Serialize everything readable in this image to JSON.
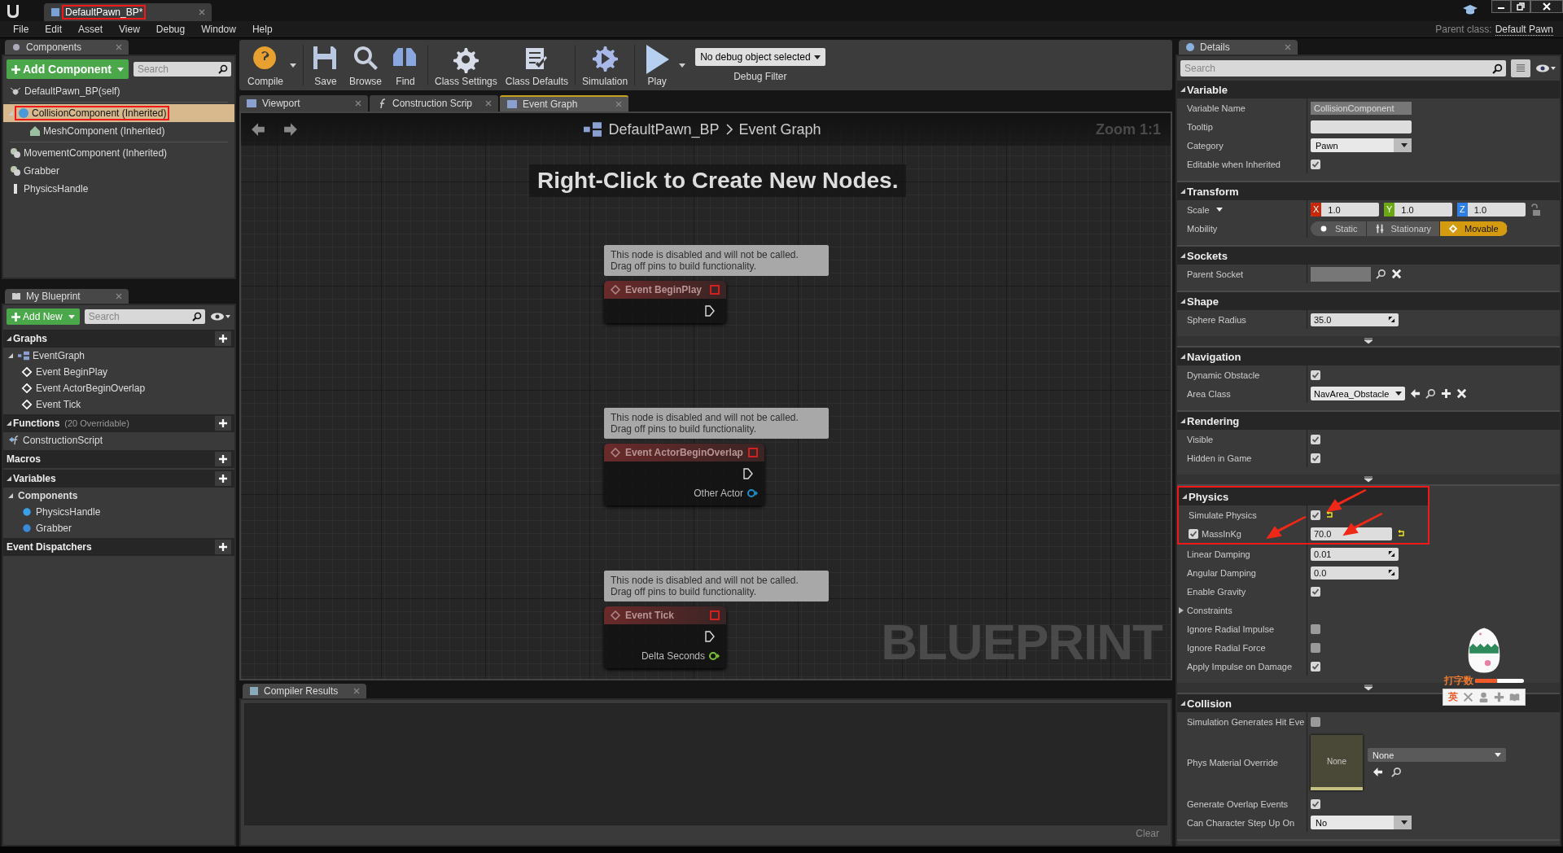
{
  "window": {
    "tab": "DefaultPawn_BP*",
    "tab_highlighted": true,
    "parent_class_label": "Parent class:",
    "parent_class": "Default Pawn"
  },
  "menu": [
    "File",
    "Edit",
    "Asset",
    "View",
    "Debug",
    "Window",
    "Help"
  ],
  "components_panel": {
    "title": "Components",
    "add_button": "Add Component",
    "search_placeholder": "Search",
    "self": "DefaultPawn_BP(self)",
    "items": [
      {
        "label": "CollisionComponent (Inherited)",
        "kind": "sphere",
        "selected": true,
        "highlighted": true,
        "children": [
          {
            "label": "MeshComponent (Inherited)",
            "kind": "mesh",
            "selected": false,
            "highlighted": false
          }
        ]
      },
      {
        "label": "MovementComponent (Inherited)",
        "kind": "movement",
        "selected": false,
        "highlighted": false
      },
      {
        "label": "Grabber",
        "kind": "grabber",
        "selected": false,
        "highlighted": false
      },
      {
        "label": "PhysicsHandle",
        "kind": "handle",
        "selected": false,
        "highlighted": false
      }
    ]
  },
  "my_blueprint": {
    "title": "My Blueprint",
    "add_button": "Add New",
    "search_placeholder": "Search",
    "sections": [
      {
        "title": "Graphs",
        "expanded": true,
        "items": [
          {
            "label": "EventGraph",
            "kind": "graph",
            "children": [
              {
                "label": "Event BeginPlay",
                "kind": "event"
              },
              {
                "label": "Event ActorBeginOverlap",
                "kind": "event"
              },
              {
                "label": "Event Tick",
                "kind": "event"
              }
            ]
          }
        ]
      },
      {
        "title": "Functions",
        "note": "(20 Overridable)",
        "expanded": true,
        "items": [
          {
            "label": "ConstructionScript",
            "kind": "function"
          }
        ]
      },
      {
        "title": "Macros"
      },
      {
        "title": "Variables",
        "expanded": true,
        "items": [
          {
            "label": "Components",
            "kind": "category",
            "children": [
              {
                "label": "PhysicsHandle",
                "kind": "handle"
              },
              {
                "label": "Grabber",
                "kind": "grabber"
              }
            ]
          }
        ]
      },
      {
        "title": "Event Dispatchers"
      }
    ]
  },
  "toolbar": [
    {
      "label": "Compile",
      "kind": "compile",
      "dropdown": true
    },
    {
      "label": "Save",
      "kind": "save",
      "dropdown": false
    },
    {
      "label": "Browse",
      "kind": "browse",
      "dropdown": false
    },
    {
      "label": "Find",
      "kind": "find",
      "dropdown": false
    },
    {
      "label": "Class Settings",
      "kind": "settings",
      "dropdown": false
    },
    {
      "label": "Class Defaults",
      "kind": "defaults",
      "dropdown": false
    },
    {
      "label": "Simulation",
      "kind": "simulation",
      "dropdown": false
    },
    {
      "label": "Play",
      "kind": "play",
      "dropdown": true
    }
  ],
  "debug_filter": {
    "value": "No debug object selected",
    "label": "Debug Filter"
  },
  "doc_tabs": [
    {
      "label": "Viewport",
      "kind": "viewport",
      "selected": false
    },
    {
      "label": "Construction Scrip",
      "kind": "function",
      "selected": false
    },
    {
      "label": "Event Graph",
      "kind": "graph",
      "selected": true
    }
  ],
  "graph": {
    "breadcrumb": [
      "DefaultPawn_BP",
      "Event Graph"
    ],
    "zoom": "Zoom 1:1",
    "hint": "Right-Click to Create New Nodes.",
    "watermark": "BLUEPRINT",
    "nodes": [
      {
        "comment": [
          "This node is disabled and will not be called.",
          "Drag off pins to build functionality."
        ],
        "title": "Event BeginPlay"
      },
      {
        "comment": [
          "This node is disabled and will not be called.",
          "Drag off pins to build functionality."
        ],
        "title": "Event ActorBeginOverlap",
        "pin": {
          "label": "Other Actor",
          "color": "#1a8fd0"
        }
      },
      {
        "comment": [
          "This node is disabled and will not be called.",
          "Drag off pins to build functionality."
        ],
        "title": "Event Tick",
        "pin": {
          "label": "Delta Seconds",
          "color": "#7cc432"
        }
      }
    ]
  },
  "compiler_results": {
    "title": "Compiler Results",
    "clear": "Clear"
  },
  "details": {
    "title": "Details",
    "search_placeholder": "Search",
    "sections": [
      {
        "title": "Variable",
        "rows": [
          {
            "label": "Variable Name",
            "kind": "readonly",
            "value": "CollisionComponent"
          },
          {
            "label": "Tooltip",
            "kind": "text"
          },
          {
            "label": "Category",
            "kind": "combo",
            "value": "Pawn"
          },
          {
            "label": "Editable when Inherited",
            "kind": "check",
            "checked": true
          }
        ]
      },
      {
        "title": "Transform",
        "rows": [
          {
            "label": "Scale",
            "kind": "vector",
            "values": [
              {
                "axis": "X",
                "value": "1.0",
                "color": "#c8280a"
              },
              {
                "axis": "Y",
                "value": "1.0",
                "color": "#6aa814"
              },
              {
                "axis": "Z",
                "value": "1.0",
                "color": "#2e7ee8"
              }
            ]
          },
          {
            "label": "Mobility",
            "kind": "segmented",
            "options": [
              {
                "label": "Static",
                "kind": "static",
                "selected": false
              },
              {
                "label": "Stationary",
                "kind": "stationary",
                "selected": false
              },
              {
                "label": "Movable",
                "kind": "movable",
                "selected": true
              }
            ]
          }
        ]
      },
      {
        "title": "Sockets",
        "rows": [
          {
            "label": "Parent Socket",
            "kind": "socket"
          }
        ]
      },
      {
        "title": "Shape",
        "advanced": true,
        "rows": [
          {
            "label": "Sphere Radius",
            "kind": "number",
            "value": "35.0"
          }
        ]
      },
      {
        "title": "Navigation",
        "rows": [
          {
            "label": "Dynamic Obstacle",
            "kind": "check",
            "checked": true
          },
          {
            "label": "Area Class",
            "kind": "class",
            "value": "NavArea_Obstacle"
          }
        ]
      },
      {
        "title": "Rendering",
        "advanced": true,
        "rows": [
          {
            "label": "Visible",
            "kind": "check",
            "checked": true
          },
          {
            "label": "Hidden in Game",
            "kind": "check",
            "checked": true
          }
        ]
      },
      {
        "title": "Physics",
        "highlighted": true,
        "advanced": true,
        "rows": [
          {
            "label": "Simulate Physics",
            "kind": "check",
            "checked": true,
            "reset": true,
            "highlighted": true,
            "arrow_to_value": true,
            "arrow_to_label": false
          },
          {
            "label": "MassInKg",
            "kind": "override",
            "override_checked": true,
            "value": "70.0",
            "reset": true,
            "highlighted": true,
            "arrow_to_value": true,
            "arrow_to_label": true
          },
          {
            "label": "Linear Damping",
            "kind": "number",
            "value": "0.01"
          },
          {
            "label": "Angular Damping",
            "kind": "number",
            "value": "0.0"
          },
          {
            "label": "Enable Gravity",
            "kind": "check",
            "checked": true
          },
          {
            "label": "Constraints",
            "kind": "group",
            "expanded": false
          },
          {
            "label": "Ignore Radial Impulse",
            "kind": "check",
            "checked": false
          },
          {
            "label": "Ignore Radial Force",
            "kind": "check",
            "checked": false
          },
          {
            "label": "Apply Impulse on Damage",
            "kind": "check",
            "checked": true
          }
        ]
      },
      {
        "title": "Collision",
        "rows": [
          {
            "label": "Simulation Generates Hit Eve",
            "kind": "check",
            "checked": false
          },
          {
            "label": "Phys Material Override",
            "kind": "asset",
            "thumb": "None",
            "value": "None"
          },
          {
            "label": "Generate Overlap Events",
            "kind": "check",
            "checked": true
          },
          {
            "label": "Can Character Step Up On",
            "kind": "combo",
            "value": "No"
          }
        ]
      }
    ]
  },
  "ime_widget": {
    "label": "打字数",
    "level": 0.45,
    "mode": "英"
  }
}
